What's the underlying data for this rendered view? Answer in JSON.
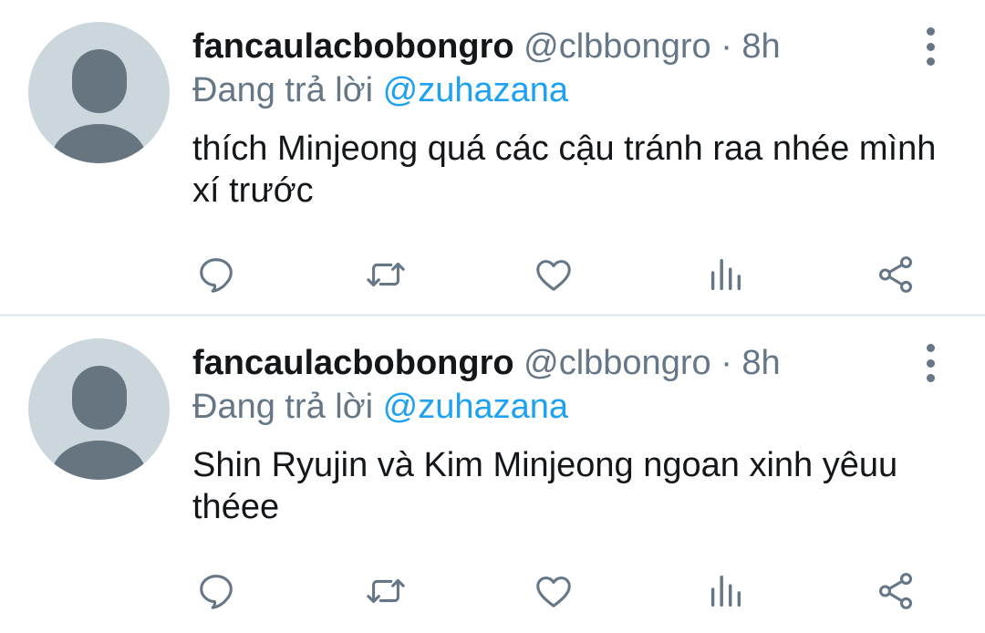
{
  "tweets": [
    {
      "display_name": "fancaulacbobongro",
      "handle": "@clbbongro",
      "separator": "·",
      "time": "8h",
      "reply_prefix": "Đang trả lời",
      "reply_to": "@zuhazana",
      "text": "thích Minjeong quá các cậu tránh raa nhée mình xí trước"
    },
    {
      "display_name": "fancaulacbobongro",
      "handle": "@clbbongro",
      "separator": "·",
      "time": "8h",
      "reply_prefix": "Đang trả lời",
      "reply_to": "@zuhazana",
      "text": "Shin Ryujin và Kim Minjeong ngoan xinh yêuu théee"
    }
  ],
  "icons": {
    "reply": "comment-bubble-icon",
    "retweet": "retweet-arrows-icon",
    "like": "heart-icon",
    "stats": "bar-chart-icon",
    "share": "share-nodes-icon",
    "more": "vertical-ellipsis-icon"
  },
  "colors": {
    "text": "#14171a",
    "muted": "#657786",
    "link": "#1da1f2",
    "avatar_bg": "#ccd6dd",
    "avatar_fg": "#66757f",
    "divider": "#e6ecf0"
  }
}
